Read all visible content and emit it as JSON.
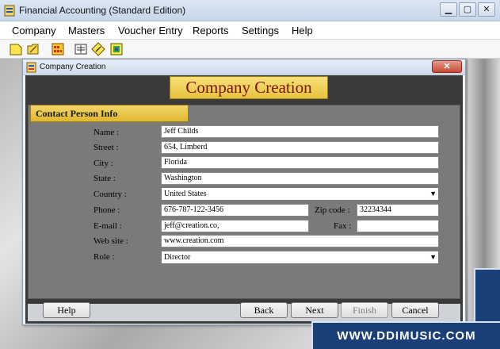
{
  "window": {
    "title": "Financial Accounting (Standard Edition)"
  },
  "menu": [
    "Company",
    "Masters",
    "Voucher Entry",
    "Reports",
    "Settings",
    "Help"
  ],
  "toolbar": {
    "icons": [
      "new-company-icon",
      "open-company-icon",
      "calendar-icon",
      "ledger-icon",
      "edit-icon",
      "export-icon"
    ]
  },
  "dialog": {
    "title": "Company Creation",
    "close_label": "✕",
    "banner": "Company Creation",
    "section_title": "Contact Person Info",
    "fields": {
      "name": {
        "label": "Name :",
        "value": "Jeff Childs"
      },
      "street": {
        "label": "Street :",
        "value": "654, Limberd"
      },
      "city": {
        "label": "City :",
        "value": "Florida"
      },
      "state": {
        "label": "State :",
        "value": "Washington"
      },
      "country": {
        "label": "Country :",
        "value": "United States"
      },
      "phone": {
        "label": "Phone :",
        "value": "676-787-122-3456"
      },
      "zip": {
        "label": "Zip code :",
        "value": "32234344"
      },
      "email": {
        "label": "E-mail :",
        "value": "jeff@creation.co,"
      },
      "fax": {
        "label": "Fax :",
        "value": ""
      },
      "website": {
        "label": "Web site :",
        "value": "www.creation.com"
      },
      "role": {
        "label": "Role :",
        "value": "Director"
      }
    },
    "buttons": {
      "help": "Help",
      "back": "Back",
      "next": "Next",
      "finish": "Finish",
      "cancel": "Cancel"
    }
  },
  "watermark": {
    "text": "WWW.DDIMUSIC.COM"
  }
}
